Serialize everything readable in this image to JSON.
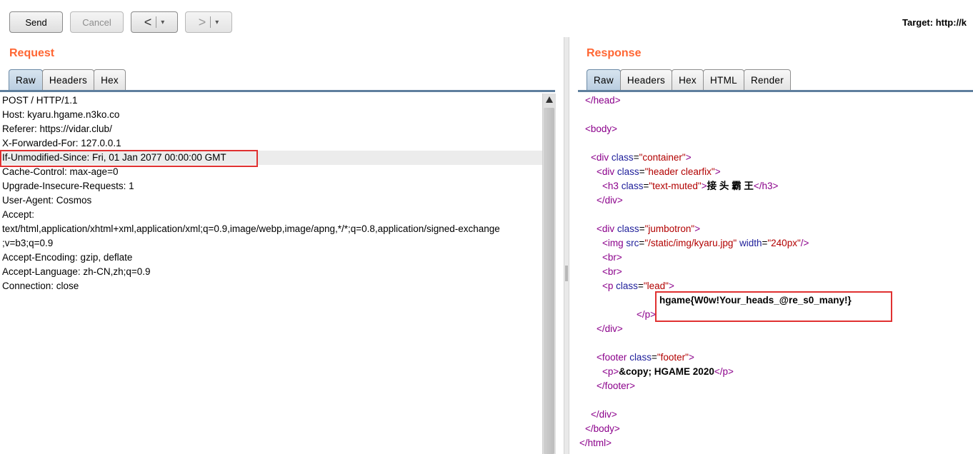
{
  "toolbar": {
    "send_label": "Send",
    "cancel_label": "Cancel",
    "back_glyph": "<",
    "forward_glyph": ">",
    "dropdown_glyph": "▾",
    "target_label": "Target: http://k"
  },
  "request": {
    "title": "Request",
    "tabs": [
      "Raw",
      "Headers",
      "Hex"
    ],
    "lines": [
      "POST / HTTP/1.1",
      "Host: kyaru.hgame.n3ko.co",
      "Referer: https://vidar.club/",
      "X-Forwarded-For: 127.0.0.1",
      "If-Unmodified-Since: Fri, 01 Jan 2077 00:00:00 GMT",
      "Cache-Control: max-age=0",
      "Upgrade-Insecure-Requests: 1",
      "User-Agent: Cosmos",
      "Accept:",
      "text/html,application/xhtml+xml,application/xml;q=0.9,image/webp,image/apng,*/*;q=0.8,application/signed-exchange",
      ";v=b3;q=0.9",
      "Accept-Encoding: gzip, deflate",
      "Accept-Language: zh-CN,zh;q=0.9",
      "Connection: close"
    ]
  },
  "response": {
    "title": "Response",
    "tabs": [
      "Raw",
      "Headers",
      "Hex",
      "HTML",
      "Render"
    ],
    "code": {
      "head_close": "head",
      "body": "body",
      "div": "div",
      "class_attr": "class",
      "src_attr": "src",
      "width_attr": "width",
      "container": "\"container\"",
      "header_clearfix": "\"header clearfix\"",
      "h3": "h3",
      "text_muted": "\"text-muted\"",
      "h3_text": "接 头 霸 王",
      "jumbotron": "\"jumbotron\"",
      "img": "img",
      "img_src": "\"/static/img/kyaru.jpg\"",
      "img_width": "\"240px\"",
      "br": "br",
      "p": "p",
      "lead": "\"lead\"",
      "flag": "hgame{W0w!Your_heads_@re_s0_many!}",
      "footer": "footer",
      "footer_class": "\"footer\"",
      "footer_text": "&copy; HGAME 2020",
      "html": "html"
    }
  }
}
